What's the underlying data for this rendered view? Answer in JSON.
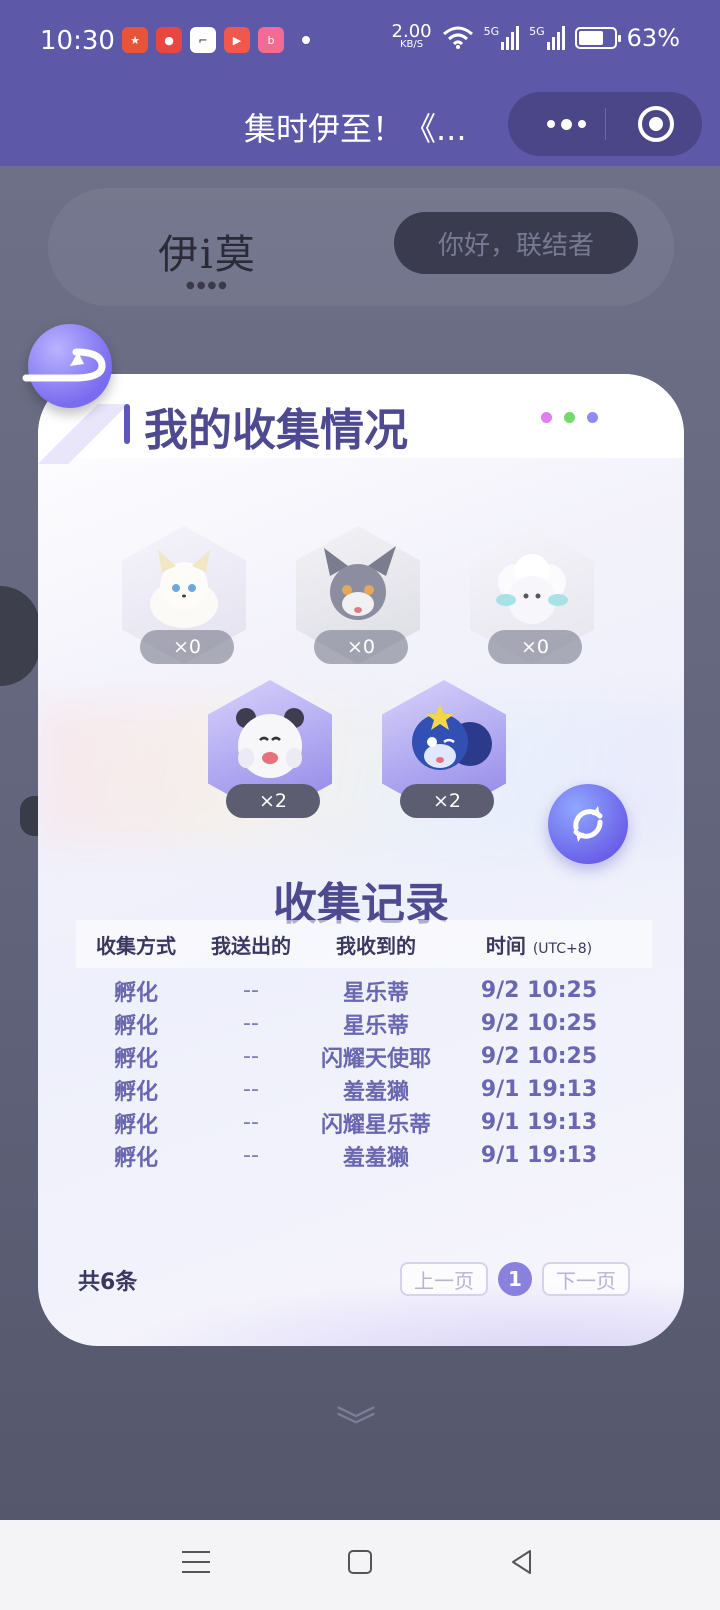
{
  "status_bar": {
    "time": "10:30",
    "network_speed": "2.00",
    "network_unit": "KB/S",
    "signal1_label": "5G",
    "signal2_label": "5G",
    "battery": "63%",
    "apps": [
      {
        "name": "game-app-icon",
        "color": "#e8543a"
      },
      {
        "name": "pig-app-icon",
        "color": "#e8473f"
      },
      {
        "name": "bracket-app-icon",
        "color": "#ffffff"
      },
      {
        "name": "video-app-icon",
        "color": "#f1584b"
      },
      {
        "name": "bilibili-app-icon",
        "color": "#f36b93"
      }
    ]
  },
  "title_bar": {
    "title": "集时伊至！《..."
  },
  "background_page": {
    "greeting": "你好，联结者"
  },
  "modal": {
    "title": "我的收集情况",
    "dot_colors": [
      "#e27cf2",
      "#74d86a",
      "#8e8cf0"
    ],
    "pets": [
      {
        "name": "white-fox-pet",
        "count": "×0",
        "owned": false
      },
      {
        "name": "grey-cat-pet",
        "count": "×0",
        "owned": false
      },
      {
        "name": "fluffy-sheep-pet",
        "count": "×0",
        "owned": false
      },
      {
        "name": "panda-seal-pet",
        "count": "×2",
        "owned": true
      },
      {
        "name": "blue-squirrel-pet",
        "count": "×2",
        "owned": true
      }
    ],
    "section_title": "收集记录",
    "columns": {
      "method": "收集方式",
      "sent": "我送出的",
      "received": "我收到的",
      "time": "时间",
      "time_zone": "(UTC+8)"
    },
    "records": [
      {
        "method": "孵化",
        "sent": "--",
        "received": "星乐蒂",
        "time": "9/2 10:25"
      },
      {
        "method": "孵化",
        "sent": "--",
        "received": "星乐蒂",
        "time": "9/2 10:25"
      },
      {
        "method": "孵化",
        "sent": "--",
        "received": "闪耀天使耶",
        "time": "9/2 10:25"
      },
      {
        "method": "孵化",
        "sent": "--",
        "received": "羞羞獭",
        "time": "9/1 19:13"
      },
      {
        "method": "孵化",
        "sent": "--",
        "received": "闪耀星乐蒂",
        "time": "9/1 19:13"
      },
      {
        "method": "孵化",
        "sent": "--",
        "received": "羞羞獭",
        "time": "9/1 19:13"
      }
    ],
    "total": "共6条",
    "pagination": {
      "prev": "上一页",
      "current": "1",
      "next": "下一页"
    }
  }
}
